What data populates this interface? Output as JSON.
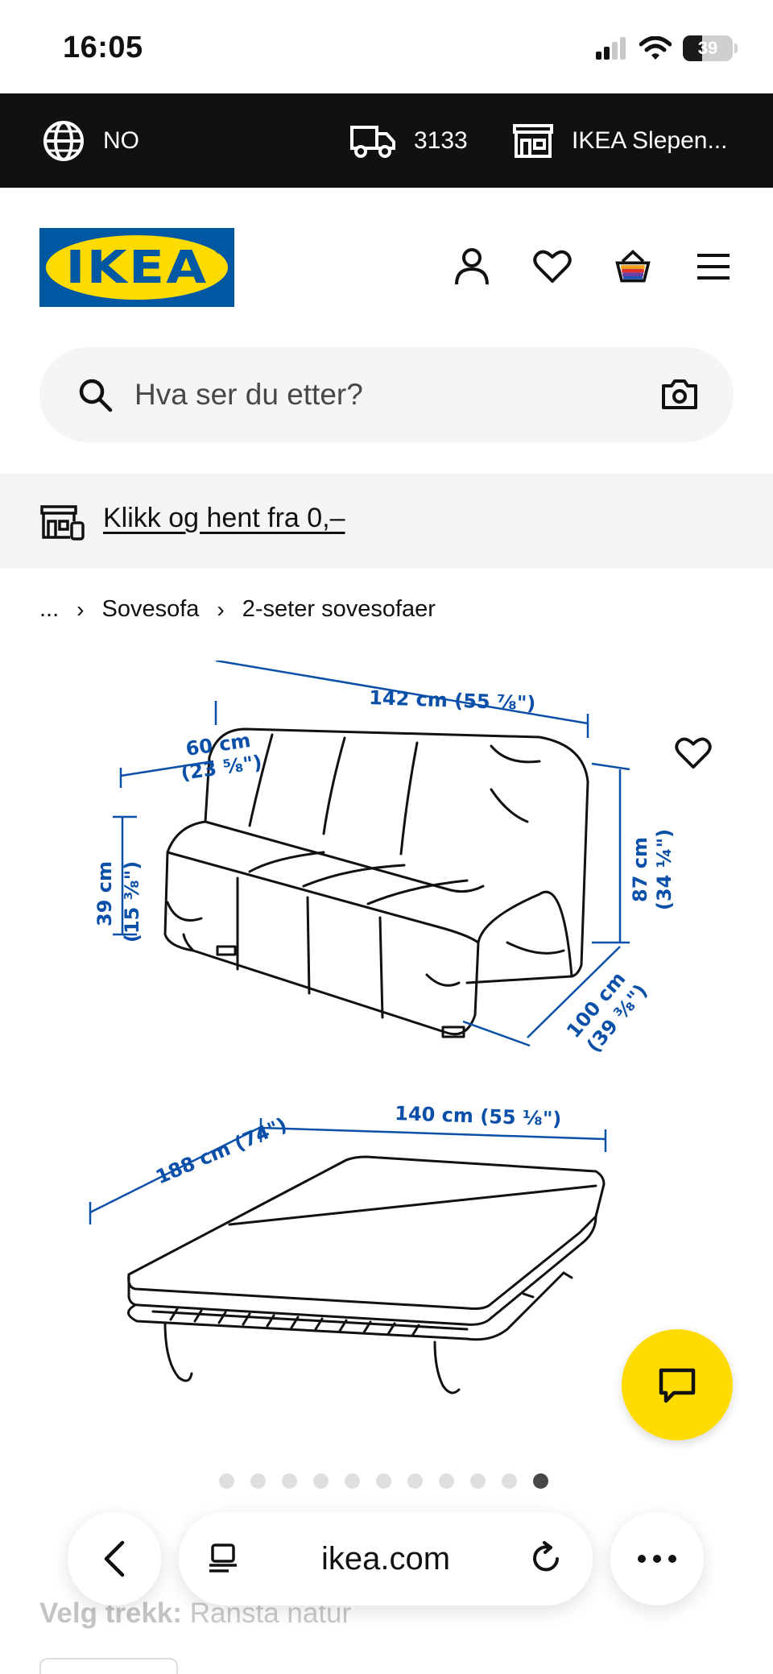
{
  "status_bar": {
    "time": "16:05",
    "battery": "39",
    "battery_level": 0.39
  },
  "topbar": {
    "language": "NO",
    "postcode": "3133",
    "store": "IKEA Slepen..."
  },
  "header": {
    "logo_text": "IKEA"
  },
  "search": {
    "placeholder": "Hva ser du etter?"
  },
  "collect": {
    "link_text": "Klikk og hent fra 0,–"
  },
  "breadcrumb": {
    "ellipsis": "...",
    "items": [
      "Sovesofa",
      "2-seter sovesofaer"
    ]
  },
  "product_image": {
    "dimensions": {
      "width": "142 cm (55 ⅞\")",
      "depth_seat": "60 cm",
      "depth_seat_in": "(23 ⁵⁄₈\")",
      "seat_height": "39 cm",
      "seat_height_in": "(15 ³⁄₈\")",
      "height": "87 cm",
      "height_in": "(34 ¼\")",
      "depth": "100 cm",
      "depth_in": "(39 ³⁄₈\")",
      "bed_width": "140 cm (55 ⅛\")",
      "bed_length": "188 cm (74\")"
    },
    "dimension_color": "#0a4fa8"
  },
  "pager": {
    "count": 11,
    "active_index": 10
  },
  "product": {
    "cover_label": "Velg trekk:",
    "cover_value": "Ransta natur"
  },
  "browser": {
    "url": "ikea.com"
  },
  "colors": {
    "ikea_blue": "#0058a3",
    "ikea_yellow": "#ffdb00",
    "topbar_bg": "#111111"
  }
}
